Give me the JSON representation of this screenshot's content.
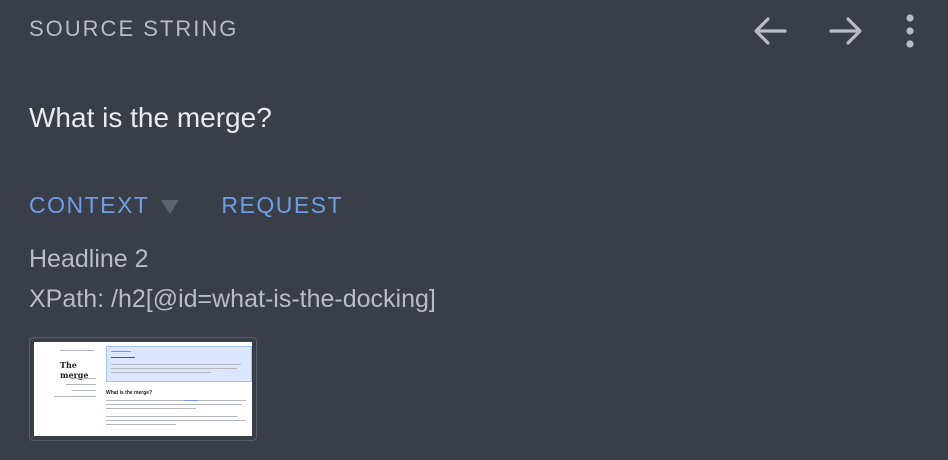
{
  "header": {
    "title": "SOURCE STRING",
    "actions": [
      {
        "name": "back",
        "icon": "arrow-left-icon"
      },
      {
        "name": "forward",
        "icon": "arrow-right-icon"
      },
      {
        "name": "more",
        "icon": "more-vertical-icon"
      }
    ]
  },
  "source": {
    "text": "What is the merge?"
  },
  "tabs": {
    "context_label": "CONTEXT",
    "request_label": "REQUEST",
    "active": "CONTEXT"
  },
  "context": {
    "element_type": "Headline 2",
    "xpath": "XPath: /h2[@id=what-is-the-docking]"
  },
  "screenshot": {
    "page_title": "The merge",
    "heading": "What is the merge?"
  },
  "colors": {
    "background": "#3a3e48",
    "accent": "#6f9de6",
    "primary_text": "#e8eaed",
    "secondary_text": "#b9bcc3"
  }
}
